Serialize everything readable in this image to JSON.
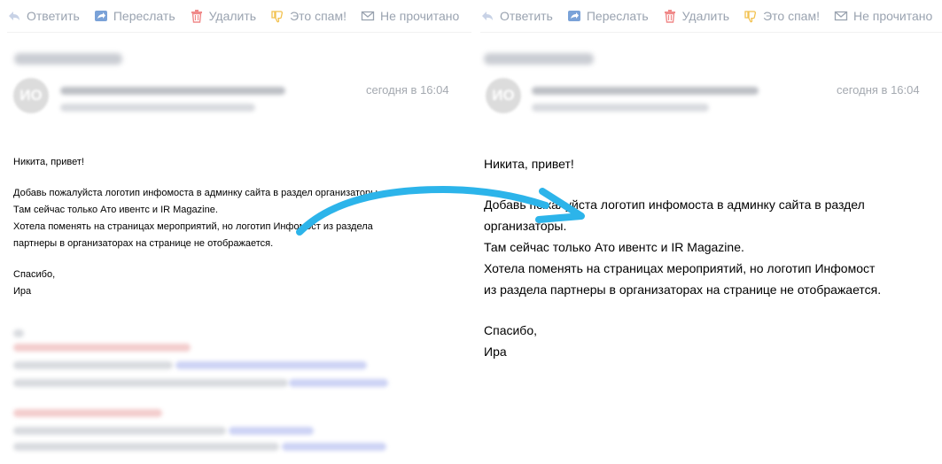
{
  "toolbar": {
    "reply": "Ответить",
    "forward": "Переслать",
    "delete": "Удалить",
    "spam": "Это спам!",
    "unread": "Не прочитано"
  },
  "message": {
    "avatar_initials": "ИО",
    "date": "сегодня в 16:04"
  },
  "body": {
    "greeting": "Никита, привет!",
    "left_lines": [
      "Добавь пожалуйста логотип инфомоста в админку сайта в раздел организаторы.",
      "Там сейчас только Ато ивентс и IR Magazine.",
      "Хотела поменять на страницах мероприятий, но логотип Инфомост из раздела",
      "партнеры в организаторах на странице не отображается."
    ],
    "right_lines": [
      "Добавь пожалуйста логотип инфомоста в админку сайта в раздел",
      "организаторы.",
      "Там сейчас только Ато ивентс и IR Magazine.",
      "Хотела поменять на страницах мероприятий, но логотип Инфомост",
      "из раздела партнеры в организаторах на странице не отображается."
    ],
    "thanks": "Спасибо,",
    "signature": "Ира"
  },
  "colors": {
    "toolbar_text": "#9aa3b0",
    "reply_icon": "#c8d2e6",
    "forward_icon": "#7aa2d8",
    "delete_icon": "#f08a8a",
    "spam_icon": "#f2c14e",
    "unread_icon": "#9aa3b0",
    "arrow": "#2cb4ea"
  },
  "icons": {
    "reply": "reply-icon",
    "forward": "forward-icon",
    "delete": "trash-icon",
    "spam": "thumbs-down-icon",
    "unread": "envelope-icon",
    "archive": "archive-icon"
  }
}
